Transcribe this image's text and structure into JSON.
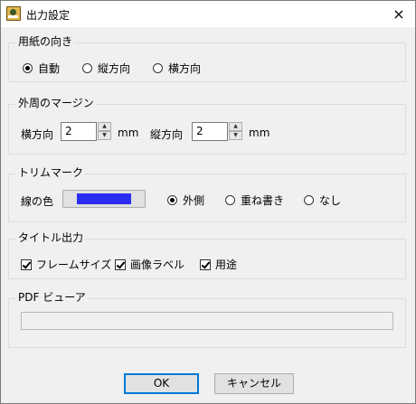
{
  "window": {
    "title": "出力設定",
    "close_icon": "×"
  },
  "orientation": {
    "title": "用紙の向き",
    "options": [
      {
        "label": "自動",
        "selected": true
      },
      {
        "label": "縦方向",
        "selected": false
      },
      {
        "label": "横方向",
        "selected": false
      }
    ]
  },
  "margins": {
    "title": "外周のマージン",
    "horizontal": {
      "label": "横方向",
      "value": "2",
      "unit": "mm"
    },
    "vertical": {
      "label": "縦方向",
      "value": "2",
      "unit": "mm"
    }
  },
  "trim": {
    "title": "トリムマーク",
    "line_color_label": "線の色",
    "line_color": "#2a2df0",
    "options": [
      {
        "label": "外側",
        "selected": true
      },
      {
        "label": "重ね書き",
        "selected": false
      },
      {
        "label": "なし",
        "selected": false
      }
    ]
  },
  "title_output": {
    "title": "タイトル出力",
    "items": [
      {
        "label": "フレームサイズ",
        "checked": true
      },
      {
        "label": "画像ラベル",
        "checked": true
      },
      {
        "label": "用途",
        "checked": true
      }
    ]
  },
  "pdf_viewer": {
    "title": "PDF ビューア",
    "value": ""
  },
  "buttons": {
    "ok": "OK",
    "cancel": "キャンセル"
  }
}
